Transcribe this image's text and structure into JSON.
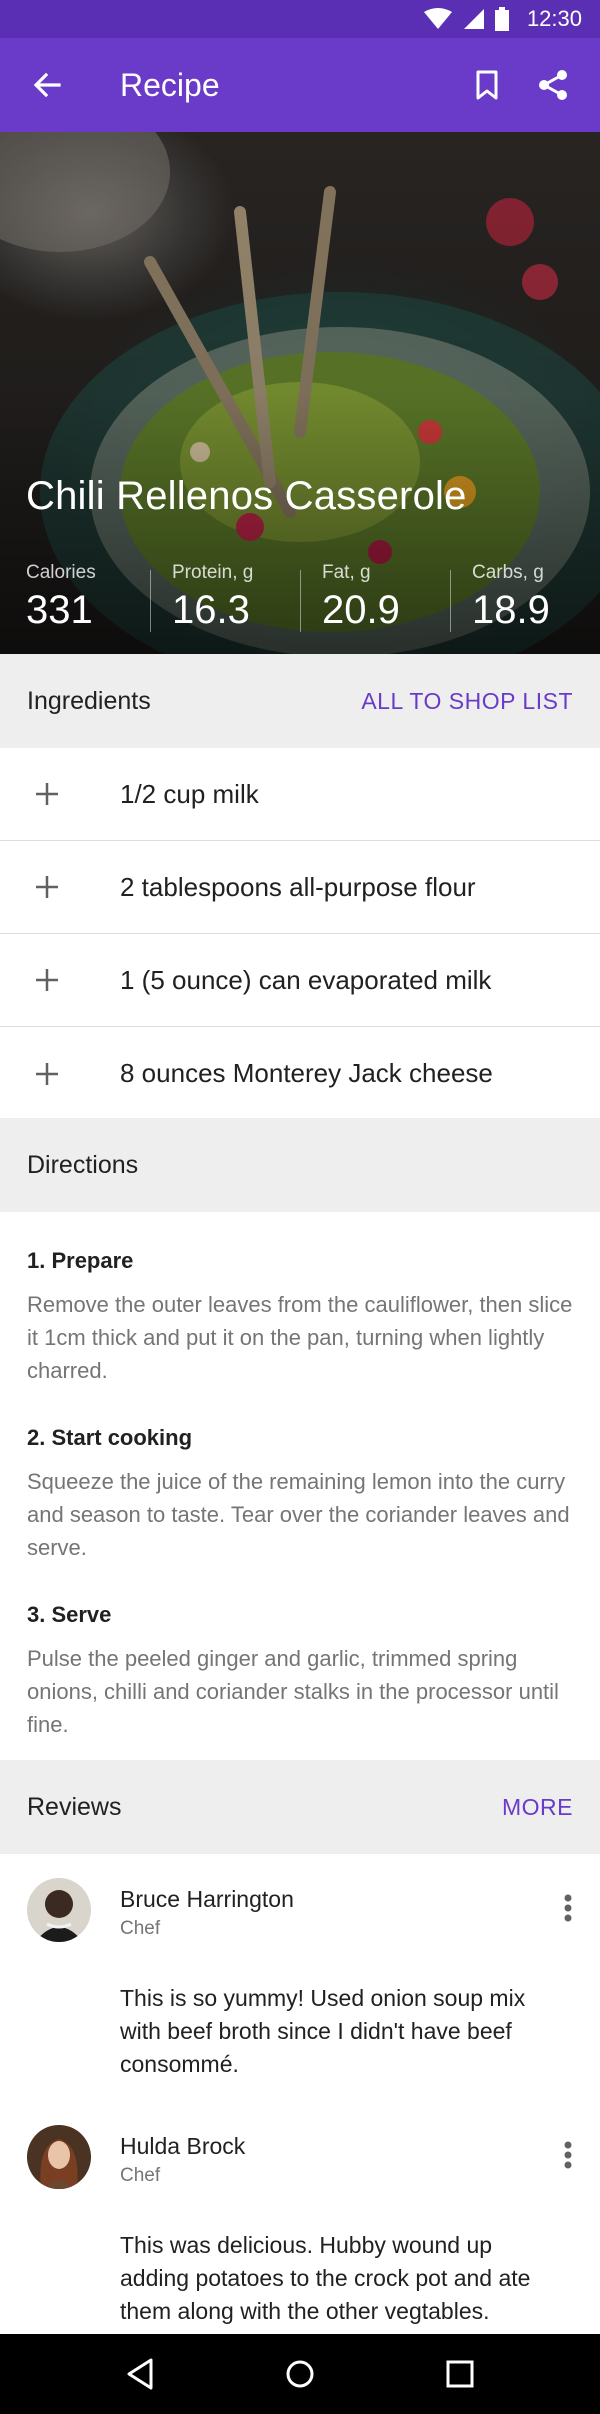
{
  "status_bar": {
    "time": "12:30"
  },
  "app_bar": {
    "title": "Recipe"
  },
  "recipe": {
    "title": "Chili Rellenos Casserole",
    "nutrition": [
      {
        "label": "Calories",
        "value": "331"
      },
      {
        "label": "Protein, g",
        "value": "16.3"
      },
      {
        "label": "Fat, g",
        "value": "20.9"
      },
      {
        "label": "Carbs, g",
        "value": "18.9"
      }
    ]
  },
  "ingredients": {
    "title": "Ingredients",
    "action": "ALL TO SHOP LIST",
    "items": [
      "1/2 cup milk",
      "2 tablespoons all-purpose flour",
      "1 (5 ounce) can evaporated milk",
      "8 ounces Monterey Jack cheese"
    ]
  },
  "directions": {
    "title": "Directions",
    "steps": [
      {
        "title": "1. Prepare",
        "text": "Remove the outer leaves from the cauliflower, then slice it 1cm thick and put it on the pan, turning when lightly charred."
      },
      {
        "title": "2. Start cooking",
        "text": "Squeeze the juice of the remaining lemon into the curry and season to taste. Tear over the coriander leaves and serve."
      },
      {
        "title": "3. Serve",
        "text": "Pulse the peeled ginger and garlic, trimmed spring onions, chilli and coriander stalks in the processor until fine."
      }
    ]
  },
  "reviews": {
    "title": "Reviews",
    "action": "MORE",
    "items": [
      {
        "name": "Bruce Harrington",
        "role": "Chef",
        "comment": "This is so yummy! Used onion soup mix with beef broth since I didn't have beef consommé."
      },
      {
        "name": "Hulda Brock",
        "role": "Chef",
        "comment": "This was delicious. Hubby wound up adding potatoes to the crock pot and ate them along with the other vegtables."
      }
    ]
  },
  "colors": {
    "primary": "#6a3bc9",
    "primary_dark": "#5a2fb3",
    "section_bg": "#eeeeee",
    "secondary_text": "#757575"
  }
}
